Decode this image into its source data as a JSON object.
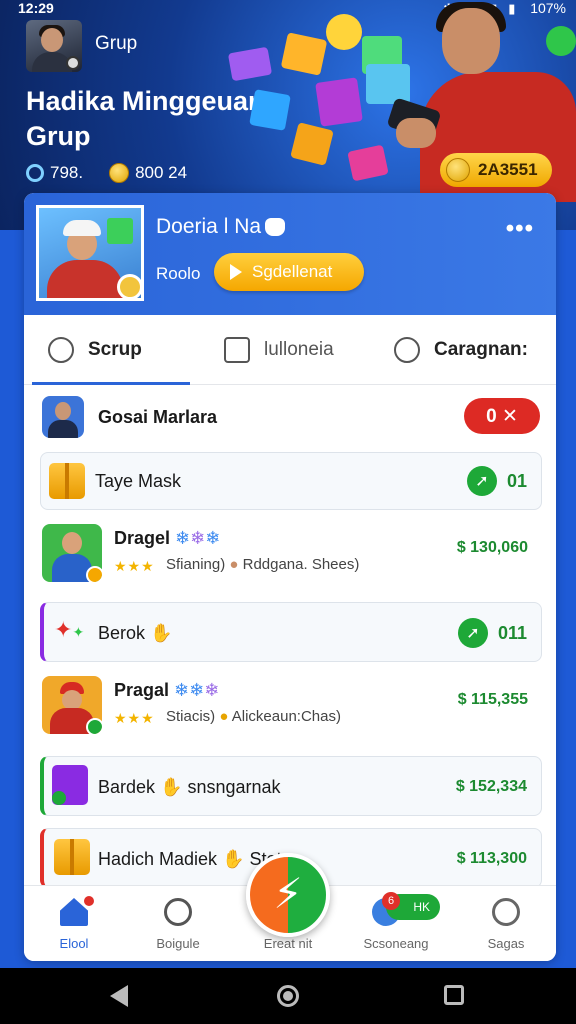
{
  "status_bar": {
    "time": "12:29",
    "battery": "107%"
  },
  "hero": {
    "group_label": "Grup",
    "title": "Hadika Minggeuan Grup",
    "members": "798.",
    "coins": "800 24",
    "coin_badge": "2A3551"
  },
  "profile": {
    "name": "Doeria l Na",
    "sub_label": "Roolo",
    "action_button": "Sgdellenat",
    "more": "•••"
  },
  "tabs": [
    {
      "label": "Scrup",
      "icon": "person-icon"
    },
    {
      "label": "lulloneia",
      "icon": "calendar-icon"
    },
    {
      "label": "Caragnan:",
      "icon": "chat-icon"
    }
  ],
  "list": [
    {
      "name": "Gosai Marlara",
      "badge": "0 ✕"
    },
    {
      "name": "Taye Mask",
      "value": "01"
    },
    {
      "name": "Dragel",
      "detail": "Sfianing)",
      "detail2": "Rddgana. Shees)",
      "amount": "$ 130,060"
    },
    {
      "name": "Berok",
      "value": "011"
    },
    {
      "name": "Pragal",
      "detail": "Stiacis)",
      "detail2": "Alickeaun:Chas)",
      "amount": "$ 115,355"
    },
    {
      "name": "Bardek",
      "extra": "snsngarnak",
      "amount": "$ 152,334"
    },
    {
      "name": "Hadich Madiek",
      "extra": "Stet",
      "amount": "$ 113,300"
    }
  ],
  "bottom_nav": [
    {
      "label": "Elool",
      "icon": "home-icon",
      "active": true
    },
    {
      "label": "Boigule",
      "icon": "chat-bubble-icon"
    },
    {
      "label": "Ereat nit",
      "icon": "bolt-icon"
    },
    {
      "label": "Scsoneang",
      "icon": "messages-icon",
      "badge": "6",
      "pill": "HK"
    },
    {
      "label": "Sagas",
      "icon": "globe-icon"
    }
  ],
  "colors": {
    "primary": "#2a64d8",
    "accent_yellow": "#f5a700",
    "positive": "#1c8a30",
    "danger": "#dd2a24"
  }
}
